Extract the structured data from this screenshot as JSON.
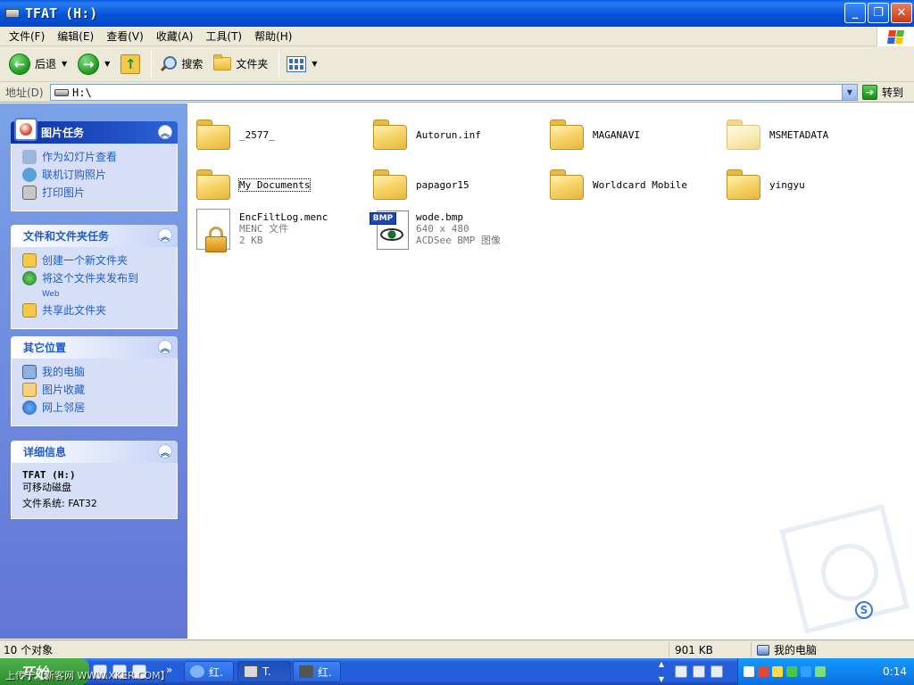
{
  "window": {
    "title": "TFAT (H:)"
  },
  "menu": [
    "文件(F)",
    "编辑(E)",
    "查看(V)",
    "收藏(A)",
    "工具(T)",
    "帮助(H)"
  ],
  "toolbar": {
    "back": "后退",
    "search": "搜索",
    "folders": "文件夹"
  },
  "address": {
    "label": "地址(D)",
    "value": "H:\\",
    "go": "转到"
  },
  "picture_tasks": {
    "title": "图片任务",
    "items": [
      "作为幻灯片查看",
      "联机订购照片",
      "打印图片"
    ]
  },
  "file_tasks": {
    "title": "文件和文件夹任务",
    "items": [
      "创建一个新文件夹",
      "将这个文件夹发布到",
      "共享此文件夹"
    ],
    "publish_suffix": "Web"
  },
  "other_places": {
    "title": "其它位置",
    "items": [
      "我的电脑",
      "图片收藏",
      "网上邻居"
    ]
  },
  "details": {
    "title": "详细信息",
    "name": "TFAT (H:)",
    "type": "可移动磁盘",
    "fs": "文件系统: FAT32"
  },
  "files": [
    {
      "name": "_2577_",
      "kind": "folder"
    },
    {
      "name": "Autorun.inf",
      "kind": "folder"
    },
    {
      "name": "MAGANAVI",
      "kind": "folder"
    },
    {
      "name": "MSMETADATA",
      "kind": "folder-hidden"
    },
    {
      "name": "My Documents",
      "kind": "folder"
    },
    {
      "name": "papagor15",
      "kind": "folder"
    },
    {
      "name": "Worldcard Mobile",
      "kind": "folder"
    },
    {
      "name": "yingyu",
      "kind": "folder"
    },
    {
      "name": "EncFiltLog.menc",
      "kind": "menc",
      "type": "MENC 文件",
      "size": "2 KB"
    },
    {
      "name": "wode.bmp",
      "kind": "bmp",
      "dims": "640 x 480",
      "type": "ACDSee BMP 图像",
      "badge": "BMP"
    }
  ],
  "status": {
    "count": "10 个对象",
    "size": "901 KB",
    "location": "我的电脑"
  },
  "taskbar": {
    "start": "开始",
    "tasks": [
      "红.",
      "T.",
      "红."
    ],
    "clock": "0:14"
  },
  "watermark": {
    "upload": "上传于【新客网 WWW.XKER.COM】",
    "logo": "S"
  },
  "colors": {
    "titlebar": "#0553d9",
    "taskpane": "#6375d6",
    "link": "#215dc6"
  }
}
